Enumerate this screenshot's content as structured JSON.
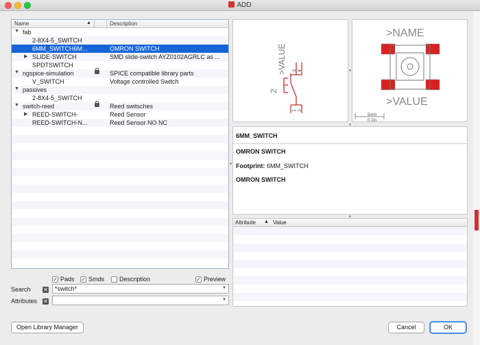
{
  "window": {
    "title": "ADD"
  },
  "tree": {
    "columns": [
      "Name",
      "Description"
    ],
    "rows": [
      {
        "name": "fab",
        "description": "",
        "level": 0,
        "expander": "▼",
        "lock": false,
        "selected": false
      },
      {
        "name": "2-8X4-5_SWITCH",
        "description": "",
        "level": 1,
        "expander": "",
        "lock": false,
        "selected": false
      },
      {
        "name": "6MM_SWITCH6M...",
        "description": "OMRON SWITCH",
        "level": 1,
        "expander": "",
        "lock": false,
        "selected": true
      },
      {
        "name": "SLIDE-SWITCH",
        "description": "SMD slide-switch AYZ0102AGRLC as ...",
        "level": 1,
        "expander": "▶",
        "lock": false,
        "selected": false
      },
      {
        "name": "SPDTSWITCH",
        "description": "",
        "level": 1,
        "expander": "",
        "lock": false,
        "selected": false
      },
      {
        "name": "ngspice-simulation",
        "description": "SPICE compatible library parts",
        "level": 0,
        "expander": "▼",
        "lock": true,
        "selected": false
      },
      {
        "name": "V_SWITCH",
        "description": "Voltage controlled Switch",
        "level": 1,
        "expander": "",
        "lock": false,
        "selected": false
      },
      {
        "name": "passives",
        "description": "",
        "level": 0,
        "expander": "▼",
        "lock": false,
        "selected": false
      },
      {
        "name": "2-8X4-5_SWITCH",
        "description": "",
        "level": 1,
        "expander": "",
        "lock": false,
        "selected": false
      },
      {
        "name": "switch-reed",
        "description": "Reed switsches",
        "level": 0,
        "expander": "▼",
        "lock": true,
        "selected": false
      },
      {
        "name": "REED-SWITCH-",
        "description": "Reed Sensor",
        "level": 1,
        "expander": "▶",
        "lock": false,
        "selected": false
      },
      {
        "name": "REED-SWITCH-N...",
        "description": "Reed Sensor NO NC",
        "level": 1,
        "expander": "",
        "lock": false,
        "selected": false
      }
    ]
  },
  "filters": {
    "pads": {
      "label": "Pads",
      "checked": true
    },
    "smds": {
      "label": "Smds",
      "checked": true
    },
    "description": {
      "label": "Description",
      "checked": false
    },
    "preview": {
      "label": "Preview",
      "checked": true
    }
  },
  "search": {
    "label": "Search",
    "value": "*switch*"
  },
  "attributes": {
    "label": "Attributes",
    "value": ""
  },
  "symbol_preview": {
    "value_text": ">VALUE",
    "pin_labels": [
      "2",
      "3",
      "4",
      "1"
    ],
    "part_number": "2"
  },
  "package_preview": {
    "name_text": ">NAME",
    "value_text": ">VALUE",
    "scale_mm": "5mm",
    "scale_in": "0.2in"
  },
  "details": {
    "title": "6MM_SWITCH",
    "description": "OMRON SWITCH",
    "footprint_label": "Footprint:",
    "footprint_value": "6MM_SWITCH",
    "extra": "OMRON SWITCH"
  },
  "attr_table": {
    "columns": [
      "Attribute",
      "Value"
    ]
  },
  "buttons": {
    "library_manager": "Open Library Manager",
    "cancel": "Cancel",
    "ok": "OK"
  },
  "colors": {
    "selection": "#1665d8",
    "accent": "#1b6fe0",
    "pad_red": "#d82222"
  }
}
